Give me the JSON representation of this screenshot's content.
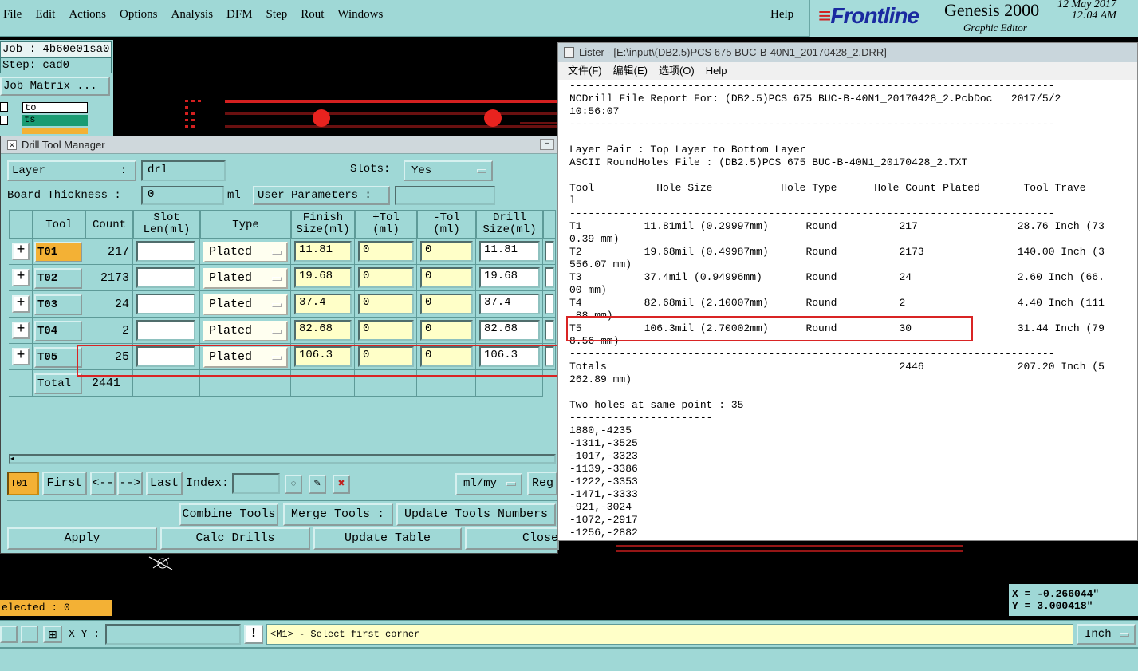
{
  "menubar": {
    "items": [
      "File",
      "Edit",
      "Actions",
      "Options",
      "Analysis",
      "DFM",
      "Step",
      "Rout",
      "Windows"
    ],
    "help": "Help",
    "brand": "Frontline",
    "product": "Genesis 2000",
    "subtitle": "Graphic Editor",
    "date": "12 May 2017",
    "time": "12:04 AM"
  },
  "job": {
    "job_line": "Job : 4b60e01sa0",
    "step_line": "Step: cad0",
    "matrix_btn": "Job Matrix ...",
    "layers": [
      "to",
      "ts"
    ]
  },
  "dtm": {
    "title": "Drill Tool Manager",
    "layer_label": "Layer",
    "layer_sep": ":",
    "layer_value": "drl",
    "slots_label": "Slots:",
    "slots_value": "Yes",
    "thickness_label": "Board Thickness  :",
    "thickness_value": "0",
    "thickness_unit": "ml",
    "user_params_label": "User Parameters  :",
    "user_params_value": "",
    "columns": [
      "Tool",
      "Count",
      "Slot\nLen(ml)",
      "Type",
      "Finish\nSize(ml)",
      "+Tol\n(ml)",
      "-Tol\n(ml)",
      "Drill\nSize(ml)"
    ],
    "rows": [
      {
        "tool": "T01",
        "count": "217",
        "type": "Plated",
        "finish": "11.81",
        "ptol": "0",
        "ntol": "0",
        "drill": "11.81"
      },
      {
        "tool": "T02",
        "count": "2173",
        "type": "Plated",
        "finish": "19.68",
        "ptol": "0",
        "ntol": "0",
        "drill": "19.68"
      },
      {
        "tool": "T03",
        "count": "24",
        "type": "Plated",
        "finish": "37.4",
        "ptol": "0",
        "ntol": "0",
        "drill": "37.4"
      },
      {
        "tool": "T04",
        "count": "2",
        "type": "Plated",
        "finish": "82.68",
        "ptol": "0",
        "ntol": "0",
        "drill": "82.68"
      },
      {
        "tool": "T05",
        "count": "25",
        "type": "Plated",
        "finish": "106.3",
        "ptol": "0",
        "ntol": "0",
        "drill": "106.3"
      }
    ],
    "total_label": "Total",
    "total_value": "2441",
    "current_tool": "T01",
    "nav": {
      "first": "First",
      "prev": "<--",
      "next": "-->",
      "last": "Last",
      "index": "Index:"
    },
    "units": "ml/my",
    "reg": "Reg",
    "combine": "Combine Tools",
    "merge": "Merge Tools  :",
    "update_numbers": "Update Tools Numbers",
    "apply": "Apply",
    "calc": "Calc Drills",
    "update_table": "Update Table",
    "close": "Close"
  },
  "lister": {
    "title": "Lister - [E:\\input\\(DB2.5)PCS 675 BUC-B-40N1_20170428_2.DRR]",
    "menu": [
      "文件(F)",
      "编辑(E)",
      "选项(O)",
      "Help"
    ],
    "lines": [
      "------------------------------------------------------------------------------",
      "NCDrill File Report For: (DB2.5)PCS 675 BUC-B-40N1_20170428_2.PcbDoc   2017/5/2",
      "10:56:07",
      "------------------------------------------------------------------------------",
      "",
      "Layer Pair : Top Layer to Bottom Layer",
      "ASCII RoundHoles File : (DB2.5)PCS 675 BUC-B-40N1_20170428_2.TXT",
      "",
      "Tool          Hole Size           Hole Type      Hole Count Plated       Tool Trave",
      "l",
      "------------------------------------------------------------------------------",
      "T1          11.81mil (0.29997mm)      Round          217                28.76 Inch (73",
      "0.39 mm)",
      "T2          19.68mil (0.49987mm)      Round          2173               140.00 Inch (3",
      "556.07 mm)",
      "T3          37.4mil (0.94996mm)       Round          24                 2.60 Inch (66.",
      "00 mm)",
      "T4          82.68mil (2.10007mm)      Round          2                  4.40 Inch (111",
      ".88 mm)",
      "T5          106.3mil (2.70002mm)      Round          30                 31.44 Inch (79",
      "8.56 mm)",
      "------------------------------------------------------------------------------",
      "Totals                                               2446               207.20 Inch (5",
      "262.89 mm)",
      "",
      "Two holes at same point : 35",
      "-----------------------",
      "1880,-4235",
      "-1311,-3525",
      "-1017,-3323",
      "-1139,-3386",
      "-1222,-3353",
      "-1471,-3333",
      "-921,-3024",
      "-1072,-2917",
      "-1256,-2882"
    ]
  },
  "status": {
    "selected": "elected : 0",
    "xy_label": "X Y :",
    "xy_value": "",
    "prompt": "<M1> - Select first corner",
    "units": "Inch",
    "x": "X = -0.266044\"",
    "y": "Y = 3.000418\""
  },
  "colors": {
    "panel": "#9fd8d6",
    "highlight": "#f3b135",
    "annot": "#d92424",
    "pad": "#e0231f"
  }
}
